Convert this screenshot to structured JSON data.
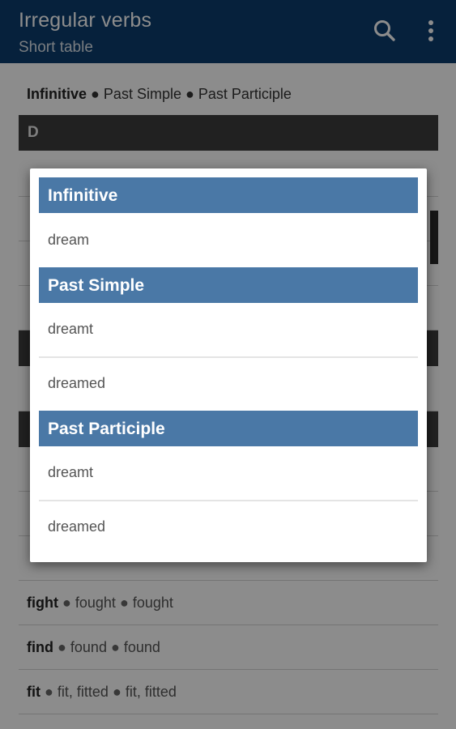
{
  "appbar": {
    "title": "Irregular verbs",
    "subtitle": "Short table",
    "search_icon": "search-icon",
    "more_icon": "more-vert-icon",
    "color": "#0b3d6e"
  },
  "list": {
    "columns_line": {
      "inf": "Infinitive",
      "sep1": "●",
      "past": "Past Simple",
      "sep2": "●",
      "part": "Past Participle"
    },
    "sections": [
      {
        "label": "D"
      }
    ],
    "rows": [
      {
        "inf": "fight",
        "sep1": "●",
        "past": "fought",
        "sep2": "●",
        "part": "fought"
      },
      {
        "inf": "find",
        "sep1": "●",
        "past": "found",
        "sep2": "●",
        "part": "found"
      },
      {
        "inf": "fit",
        "sep1": "●",
        "past": "fit, fitted",
        "sep2": "●",
        "part": "fit, fitted"
      }
    ]
  },
  "dialog": {
    "header_infinitive": "Infinitive",
    "infinitive": "dream",
    "header_past_simple": "Past Simple",
    "past_simple": [
      "dreamt",
      "dreamed"
    ],
    "header_past_participle": "Past Participle",
    "past_participle": [
      "dreamt",
      "dreamed"
    ],
    "header_color": "#4a78a6"
  }
}
